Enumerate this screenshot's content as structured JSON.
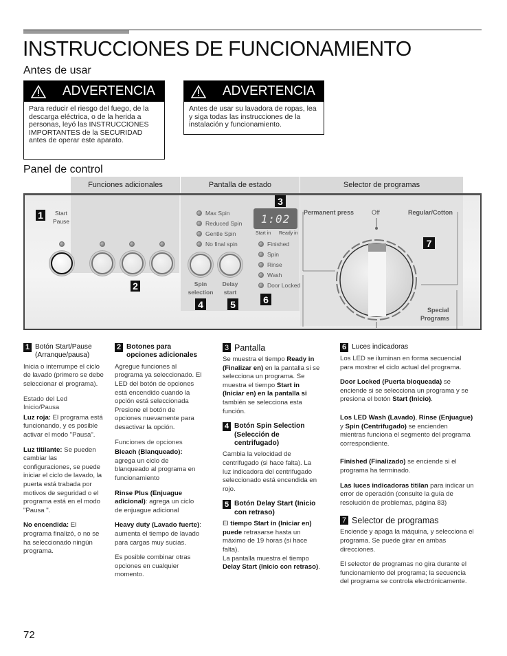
{
  "page": {
    "title": "INSTRUCCIONES DE FUNCIONAMIENTO",
    "page_number": "72"
  },
  "antes": {
    "heading": "Antes de usar",
    "warnings": [
      {
        "icon": "warning-triangle-icon",
        "title": "ADVERTENCIA",
        "text": "Para reducir el riesgo del fuego, de la descarga eléctrica, o de la herida a personas, leyó las INSTRUCCIONES IMPORTANTES de la SECURIDAD antes de operar este aparato."
      },
      {
        "icon": "warning-triangle-icon",
        "title": "ADVERTENCIA",
        "text": "Antes de usar su lavadora de ropas, lea y siga todas las instrucciones de la instalación y funcionamiento."
      }
    ]
  },
  "panel": {
    "heading": "Panel de control",
    "tabs": [
      "Funciones adicionales",
      "Pantalla de estado",
      "Selector de programas"
    ],
    "start_label_1": "Start",
    "start_label_2": "Pause",
    "spin_options": [
      "Max Spin",
      "Reduced Spin",
      "Gentle Spin",
      "No final spin"
    ],
    "spin_btn_1": "Spin",
    "spin_btn_2": "selection",
    "delay_btn_1": "Delay",
    "delay_btn_2": "start",
    "display_value": "1:02",
    "display_left": "Start in",
    "display_right": "Ready in",
    "status_leds": [
      "Finished",
      "Spin",
      "Rinse",
      "Wash",
      "Door Locked"
    ],
    "dial": {
      "left": "Permanent press",
      "top": "Off",
      "right": "Regular/Cotton",
      "bottom_1": "Special",
      "bottom_2": "Programs"
    },
    "badges": [
      "1",
      "2",
      "3",
      "4",
      "5",
      "6",
      "7"
    ]
  },
  "columns": {
    "c1": {
      "num": "1",
      "head": "Botón Start/Pause (Arranque/pausa)",
      "p1": "Inicia o interrumpe el ciclo de lavado (primero se debe seleccionar el programa).",
      "sub": "Estado del Led Inicio/Pausa",
      "red_b": "Luz roja:",
      "red_t": " El programa está funcionando, y es posible activar el modo \"Pausa\".",
      "blink_b": "Luz titilante:",
      "blink_t": " Se pueden cambiar las configuraciones, se puede iniciar el ciclo de lavado, la puerta está trabada por motivos de seguridad o el programa está en el modo \"Pausa \".",
      "off_b": "No encendida:",
      "off_t": " El programa finalizó, o no se ha seleccionado ningún programa."
    },
    "c2": {
      "num": "2",
      "head": "Botones para opciones adicionales",
      "p1": "Agregue funciones al programa ya seleccionado. El LED del botón de opciones está encendido cuando la opción está seleccionada Presione el botón de opciones nuevamente para desactivar la opción.",
      "sub": "Funciones de opciones",
      "bleach_b": "Bleach (Blanqueado):",
      "bleach_t": " agrega un ciclo de blanqueado al programa en funcionamiento",
      "rinse_b": "Rinse Plus (Enjuague adicional)",
      "rinse_t": ": agrega un ciclo de enjuague adicional",
      "heavy_b": "Heavy duty (Lavado fuerte)",
      "heavy_t": ": aumenta el tiempo de lavado para cargas muy sucias.",
      "p_last": "Es posible combinar otras opciones en cualquier momento."
    },
    "c3": {
      "num3": "3",
      "head3": "Pantalla",
      "p3_a": "Se muestra el tiempo ",
      "p3_b": "Ready in (Finalizar en)",
      "p3_c": " en la pantalla si se selecciona un programa. Se muestra el tiempo ",
      "p3_d": "Start in (Iniciar en) en la pantalla si",
      "p3_e": " también se selecciona esta función.",
      "num4": "4",
      "head4": "Botón Spin Selection (Selección de centrifugado)",
      "p4": "Cambia la velocidad de centrifugado (si hace falta). La luz indicadora del centrifugado seleccionado está encendida en rojo.",
      "num5": "5",
      "head5": "Botón Delay Start (Inicio con retraso)",
      "p5_a": "El ",
      "p5_b": "tiempo Start in (Iniciar en) puede",
      "p5_c": " retrasarse hasta un máximo de 19 horas (si hace falta).",
      "p5_d": "La pantalla muestra el tiempo ",
      "p5_e": "Delay Start (Inicio con retraso)",
      "p5_f": "."
    },
    "c4": {
      "num6": "6",
      "head6": "Luces indicadoras",
      "p6": "Los LED se iluminan en forma secuencial para mostrar el ciclo actual del programa.",
      "door_b": "Door Locked (Puerta bloqueada)",
      "door_t": " se enciende si se selecciona un programa y se presiona el botón ",
      "door_b2": "Start (Inicio)",
      "door_t2": ".",
      "leds_b1": "Los LED Wash (Lavado)",
      "leds_t1": ", ",
      "leds_b2": "Rinse (Enjuague)",
      "leds_t2": " y ",
      "leds_b3": "Spin (Centrifugado)",
      "leds_t3": " se encienden mientras funciona el segmento del programa correspondiente.",
      "fin_b": "Finished (Finalizado)",
      "fin_t": " se enciende si el programa ha terminado.",
      "err_b": "Las luces indicadoras titilan",
      "err_t": " para indicar un error de operación (consulte la guía de resolución de problemas, página 83)",
      "num7": "7",
      "head7": "Selector de programas",
      "p7a": "Enciende y apaga la máquina, y selecciona el programa. Se puede girar en ambas direcciones.",
      "p7b": "El selector de programas no gira durante el funcionamiento del programa; la secuencia del programa se controla electrónicamente."
    }
  }
}
